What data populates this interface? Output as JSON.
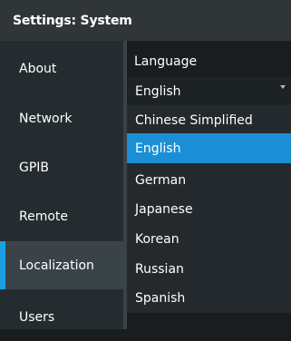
{
  "window": {
    "title": "Settings: System"
  },
  "sidebar": {
    "items": [
      {
        "label": "About"
      },
      {
        "label": "Network"
      },
      {
        "label": "GPIB"
      },
      {
        "label": "Remote"
      },
      {
        "label": "Localization",
        "active": true
      },
      {
        "label": "Users"
      }
    ]
  },
  "main": {
    "language": {
      "label": "Language",
      "value": "English",
      "options": [
        {
          "label": "Chinese Simplified"
        },
        {
          "label": "English",
          "selected": true
        },
        {
          "label": "German"
        },
        {
          "label": "Japanese"
        },
        {
          "label": "Korean"
        },
        {
          "label": "Russian"
        },
        {
          "label": "Spanish"
        }
      ]
    }
  },
  "colors": {
    "accent": "#1ba1e2",
    "selected_option": "#1a8fd6",
    "titlebar": "#303638",
    "sidebar": "#252c30",
    "sidebar_active": "#3a4348",
    "content": "#1a1d1f"
  }
}
